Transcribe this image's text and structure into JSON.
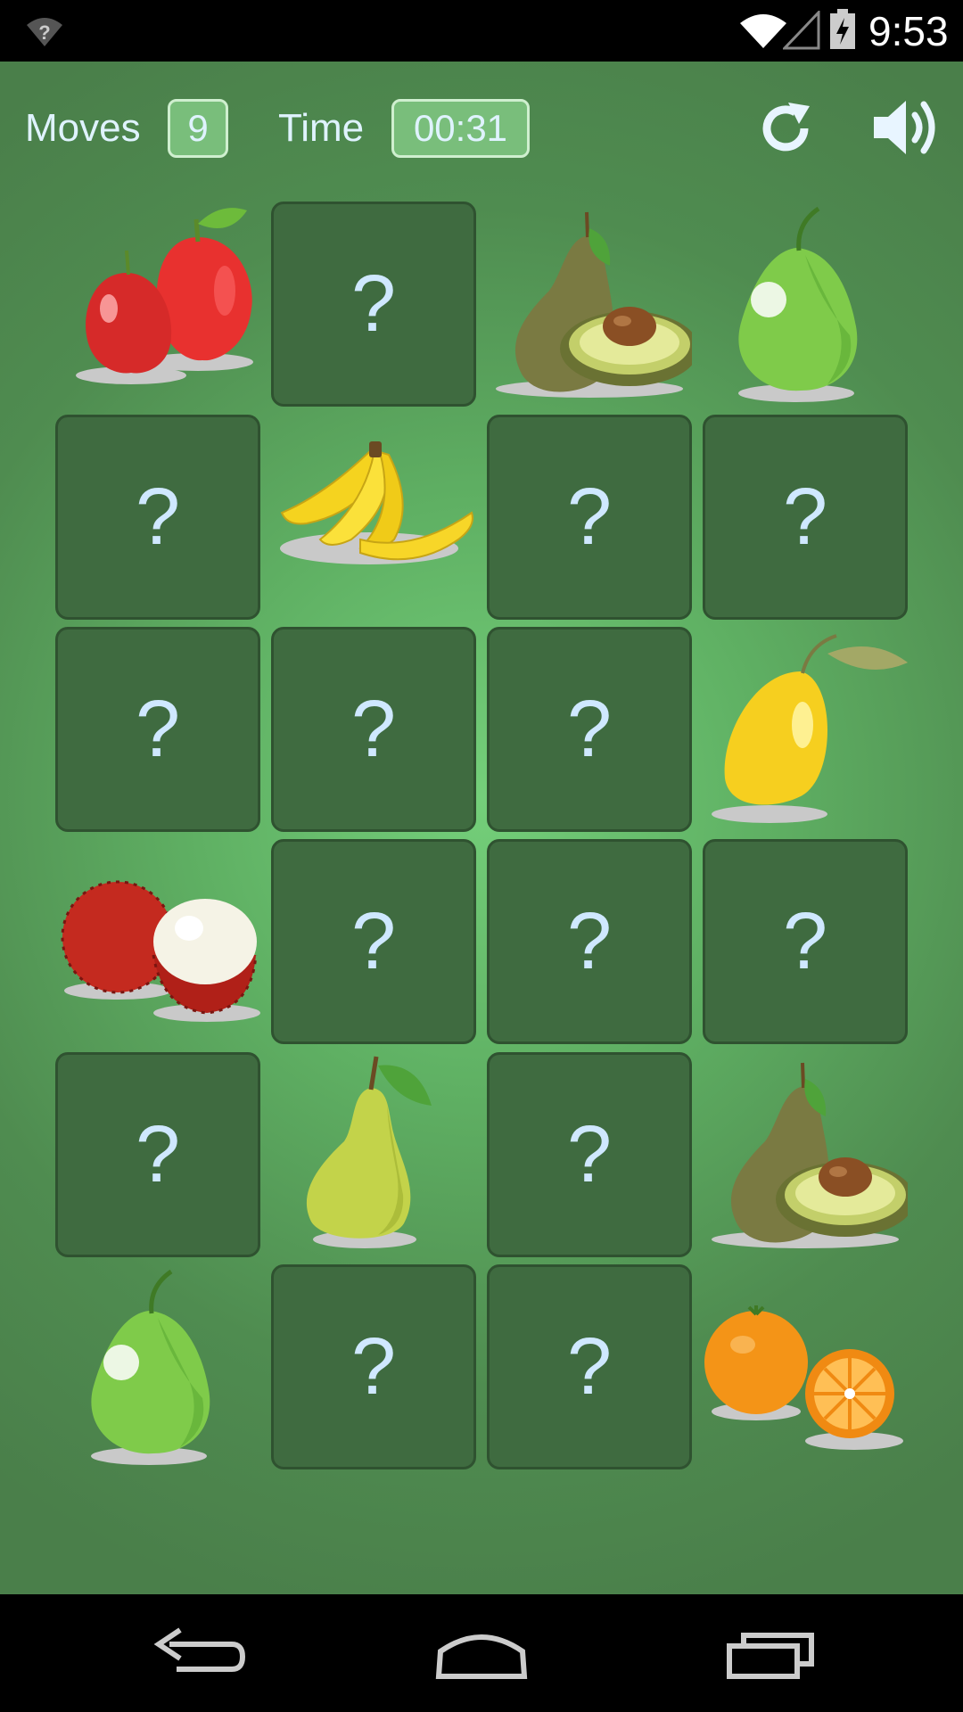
{
  "status_bar": {
    "time": "9:53"
  },
  "hud": {
    "moves_label": "Moves",
    "moves_value": "9",
    "time_label": "Time",
    "time_value": "00:31"
  },
  "card_hidden_symbol": "?",
  "board": [
    [
      "apple",
      "hidden",
      "avocado",
      "guava"
    ],
    [
      "hidden",
      "banana",
      "hidden",
      "hidden"
    ],
    [
      "hidden",
      "hidden",
      "hidden",
      "lemon"
    ],
    [
      "rambutan",
      "hidden",
      "hidden",
      "hidden"
    ],
    [
      "hidden",
      "pear",
      "hidden",
      "avocado"
    ],
    [
      "guava",
      "hidden",
      "hidden",
      "orange"
    ]
  ],
  "icons": {
    "restart": "restart-icon",
    "sound": "sound-on-icon",
    "back": "back-icon",
    "home": "home-icon",
    "recents": "recents-icon"
  },
  "colors": {
    "hidden_card": "#3f6b40",
    "hud_box": "#79be7b",
    "text": "#dff3ff"
  }
}
